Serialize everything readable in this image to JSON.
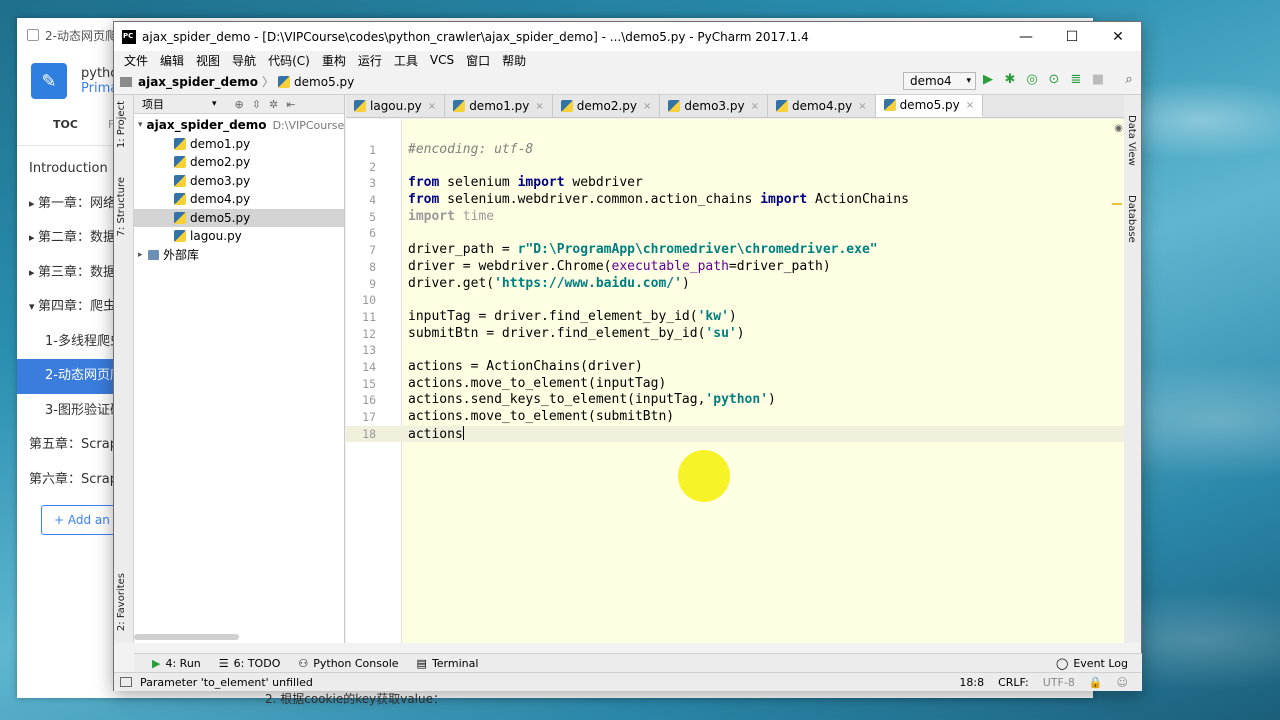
{
  "background_doc": {
    "tab_title": "2-动态网页爬虫",
    "book_title": "pytho",
    "book_subtitle": "Prima",
    "tabs": [
      "TOC",
      "F"
    ],
    "nav": [
      {
        "label": "Introduction",
        "kind": "plain"
      },
      {
        "label": "第一章：网络",
        "kind": "car"
      },
      {
        "label": "第二章：数据",
        "kind": "car"
      },
      {
        "label": "第三章：数据",
        "kind": "car"
      },
      {
        "label": "第四章：爬虫",
        "kind": "open"
      },
      {
        "label": "1-多线程爬虫",
        "kind": "sub"
      },
      {
        "label": "2-动态网页爬",
        "kind": "sub-active"
      },
      {
        "label": "3-图形验证码",
        "kind": "sub"
      },
      {
        "label": "第五章：Scrap",
        "kind": "plain"
      },
      {
        "label": "第六章：Scrap",
        "kind": "plain"
      }
    ],
    "add_button": "+ Add an a",
    "bottom_text": "2. 根据cookie的key获取value："
  },
  "window": {
    "title": "ajax_spider_demo - [D:\\VIPCourse\\codes\\python_crawler\\ajax_spider_demo] - ...\\demo5.py - PyCharm 2017.1.4",
    "minimize": "—",
    "maximize": "☐",
    "close": "✕"
  },
  "menu": [
    "文件",
    "编辑",
    "视图",
    "导航",
    "代码(C)",
    "重构",
    "运行",
    "工具",
    "VCS",
    "窗口",
    "帮助"
  ],
  "navbar": {
    "project": "ajax_spider_demo",
    "file": "demo5.py",
    "run_config": "demo4"
  },
  "left_tabs": {
    "project": "1: Project",
    "structure": "7: Structure",
    "favorites": "2: Favorites"
  },
  "right_tabs": {
    "data_view": "Data View",
    "database": "Database"
  },
  "project_panel": {
    "header": "项目",
    "root": "ajax_spider_demo",
    "root_path": "D:\\VIPCourse\\",
    "files": [
      "demo1.py",
      "demo2.py",
      "demo3.py",
      "demo4.py",
      "demo5.py",
      "lagou.py"
    ],
    "selected": "demo5.py",
    "external": "外部库"
  },
  "tabs": [
    "lagou.py",
    "demo1.py",
    "demo2.py",
    "demo3.py",
    "demo4.py",
    "demo5.py"
  ],
  "active_tab": "demo5.py",
  "line_numbers": [
    "1",
    "2",
    "3",
    "4",
    "5",
    "6",
    "7",
    "8",
    "9",
    "10",
    "11",
    "12",
    "13",
    "14",
    "15",
    "16",
    "17",
    "18"
  ],
  "bottom_tools": {
    "run": "4: Run",
    "todo": "6: TODO",
    "console": "Python Console",
    "terminal": "Terminal",
    "event_log": "Event Log"
  },
  "status": {
    "message": "Parameter 'to_element' unfilled",
    "position": "18:8",
    "line_sep": "CRLF:",
    "encoding": "UTF-8"
  }
}
